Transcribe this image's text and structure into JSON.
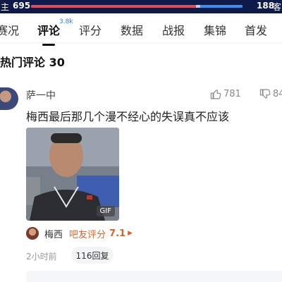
{
  "score": {
    "home_label": "主",
    "home_score": "695",
    "away_score": "188",
    "away_label": "客",
    "home_share": 0.79,
    "home_color": "#e24b5b",
    "away_color": "#3a8ff0"
  },
  "tabs": [
    {
      "label": "赛况"
    },
    {
      "label": "评论",
      "count": "3.8k",
      "active": true
    },
    {
      "label": "评分"
    },
    {
      "label": "数据"
    },
    {
      "label": "战报"
    },
    {
      "label": "集锦"
    },
    {
      "label": "首发"
    }
  ],
  "section_title": "热门评论 30",
  "comment": {
    "username": "萨一中",
    "likes": "781",
    "dislikes": "84",
    "text": "梅西最后那几个漫不经心的失误真不应该",
    "gif_label": "GIF",
    "rating": {
      "player": "梅西",
      "label": "吧友评分",
      "score": "7.1",
      "arrow": "▶"
    },
    "time": "2小时前",
    "reply_label": "116回复"
  },
  "icons": {
    "like": "thumbs-up-icon",
    "dislike": "thumbs-down-icon",
    "rating_arrow": "play-arrow-icon"
  }
}
